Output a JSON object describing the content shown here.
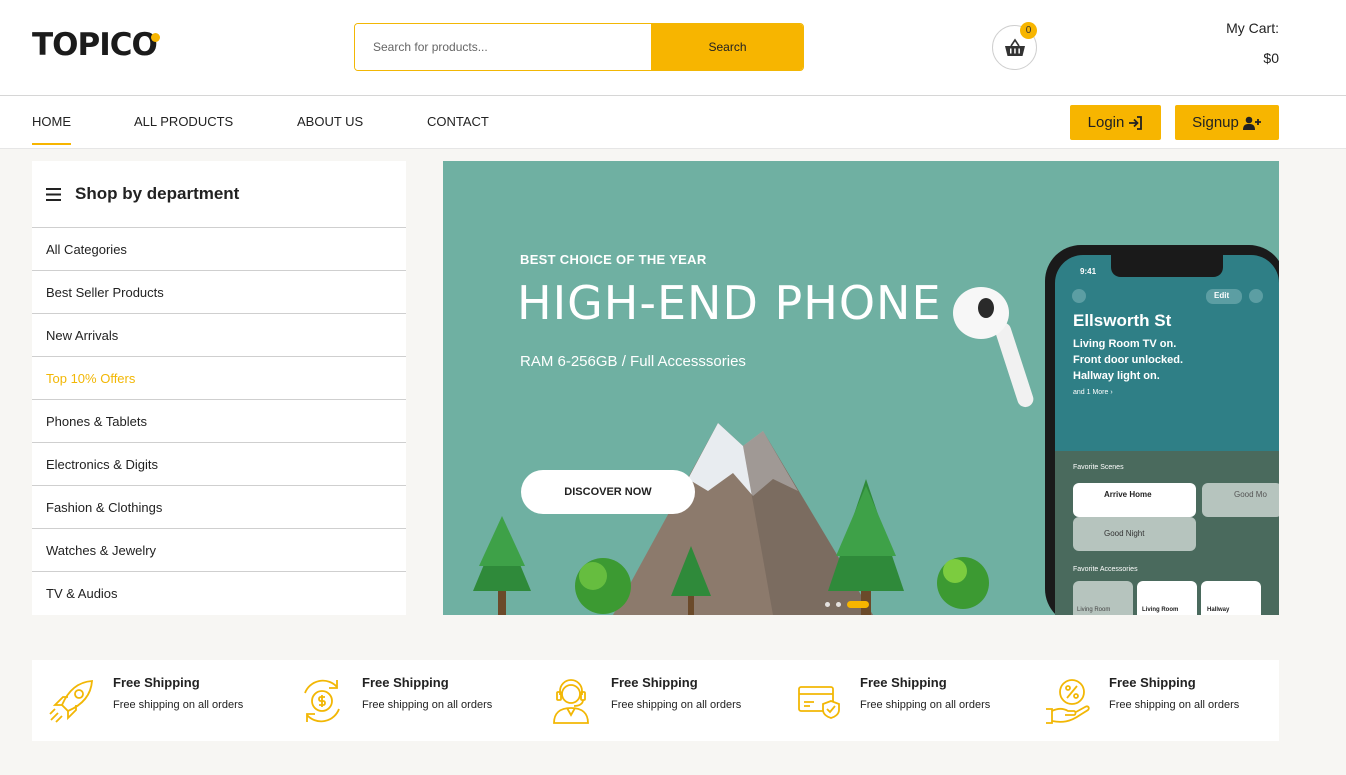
{
  "header": {
    "logo_text": "TOPICO",
    "search_placeholder": "Search for products...",
    "search_button": "Search",
    "cart_count": "0",
    "cart_label": "My Cart:",
    "cart_total": "$0"
  },
  "nav": {
    "items": [
      {
        "label": "HOME"
      },
      {
        "label": "ALL PRODUCTS"
      },
      {
        "label": "ABOUT US"
      },
      {
        "label": "CONTACT"
      }
    ],
    "login_label": "Login",
    "signup_label": "Signup"
  },
  "sidebar": {
    "title": "Shop by department",
    "items": [
      {
        "label": "All Categories"
      },
      {
        "label": "Best Seller Products"
      },
      {
        "label": "New Arrivals"
      },
      {
        "label": "Top 10% Offers"
      },
      {
        "label": "Phones & Tablets"
      },
      {
        "label": "Electronics & Digits"
      },
      {
        "label": "Fashion & Clothings"
      },
      {
        "label": "Watches & Jewelry"
      },
      {
        "label": "TV & Audios"
      }
    ]
  },
  "banner": {
    "eyebrow": "BEST CHOICE OF THE YEAR",
    "headline": "HIGH-END PHONE",
    "subtitle": "RAM 6-256GB / Full Accesssories",
    "cta": "DISCOVER NOW",
    "phone": {
      "time": "9:41",
      "edit": "Edit",
      "location": "Ellsworth St",
      "status_lines": [
        "Living Room TV on.",
        "Front door unlocked.",
        "Hallway light on."
      ],
      "more": "and 1 More ›",
      "scenes_label": "Favorite Scenes",
      "scenes": [
        "Arrive Home",
        "Good Night",
        "Good Mo"
      ],
      "accessories_label": "Favorite Accessories",
      "accessories": [
        "Living Room",
        "Living Room",
        "Hallway"
      ]
    }
  },
  "features": [
    {
      "icon": "rocket-icon",
      "title": "Free Shipping",
      "desc": "Free shipping on all orders"
    },
    {
      "icon": "money-refresh-icon",
      "title": "Free Shipping",
      "desc": "Free shipping on all orders"
    },
    {
      "icon": "support-agent-icon",
      "title": "Free Shipping",
      "desc": "Free shipping on all orders"
    },
    {
      "icon": "secure-card-icon",
      "title": "Free Shipping",
      "desc": "Free shipping on all orders"
    },
    {
      "icon": "discount-hand-icon",
      "title": "Free Shipping",
      "desc": "Free shipping on all orders"
    }
  ],
  "colors": {
    "accent": "#f7b500",
    "banner_bg": "#6fb0a2",
    "text": "#222222"
  }
}
